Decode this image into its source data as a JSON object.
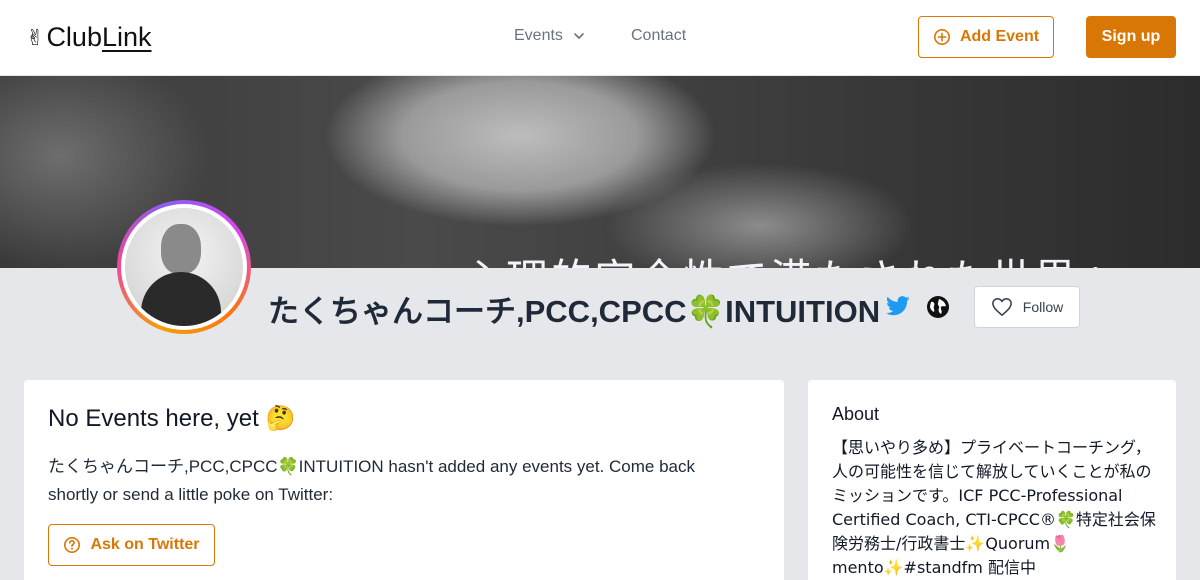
{
  "header": {
    "logo_emoji": "✌",
    "logo_text_club": "Club",
    "logo_text_link": "Link",
    "nav": {
      "events_label": "Events",
      "contact_label": "Contact"
    },
    "add_event_label": "Add Event",
    "signup_label": "Sign up",
    "accent_color": "#d97706"
  },
  "banner": {
    "overlay_text": "心理的安全性で満たされた世界へ"
  },
  "profile": {
    "name": "たくちゃんコーチ,PCC,CPCC🍀INTUITION",
    "follow_label": "Follow",
    "icons": [
      "twitter-icon",
      "globe-icon",
      "heart-icon"
    ]
  },
  "events_card": {
    "title": "No Events here, yet 🤔",
    "message": "たくちゃんコーチ,PCC,CPCC🍀INTUITION hasn't added any events yet. Come back shortly or send a little poke on Twitter:",
    "ask_button_label": "Ask on Twitter"
  },
  "about_card": {
    "title": "About",
    "text": "【思いやり多め】プライベートコーチング，人の可能性を信じて解放していくことが私のミッションです。ICF PCC-Professional Certified Coach, CTI-CPCC®🍀特定社会保険労務士/行政書士✨Quorum🌷 mento✨#standfm 配信中"
  }
}
